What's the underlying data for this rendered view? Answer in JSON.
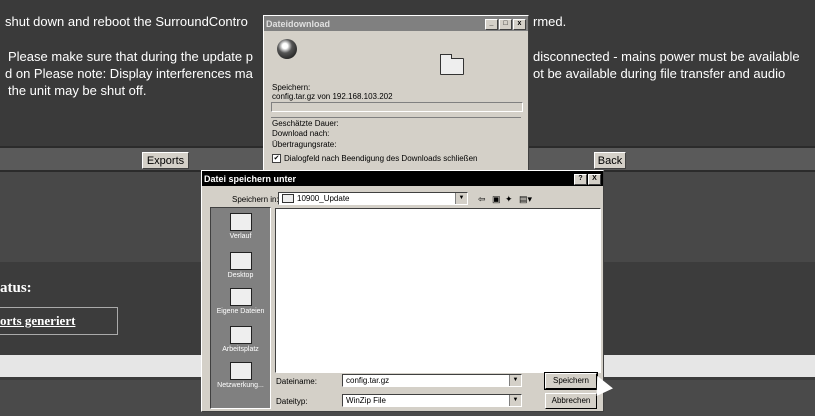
{
  "background": {
    "line1_left": "shut down and reboot the SurroundContro",
    "line1_right": "rmed.",
    "line2_left": "Please make sure that during the update p",
    "line2_right": "disconnected - mains power must be available",
    "line3_left": "d on Please note: Display interferences ma",
    "line3_right": "ot be available during file transfer and audio",
    "line4_left": "the unit may be shut off.",
    "exports_button": "Exports",
    "back_button": "Back",
    "status_label": "atus:",
    "reports_link": "orts generiert"
  },
  "download_dialog": {
    "title": "Dateidownload",
    "saving_label": "Speichern:",
    "saving_value": "config.tar.gz von 192.168.103.202",
    "estimated_label": "Geschätzte Dauer:",
    "download_to_label": "Download nach:",
    "transfer_rate_label": "Übertragungsrate:",
    "close_checkbox_label": "Dialogfeld nach Beendigung des Downloads schließen",
    "close_checkbox_checked": true
  },
  "save_dialog": {
    "title": "Datei speichern unter",
    "save_in_label": "Speichern in:",
    "save_in_value": "10900_Update",
    "places": [
      {
        "label": "Verlauf",
        "icon": "history-icon"
      },
      {
        "label": "Desktop",
        "icon": "desktop-icon"
      },
      {
        "label": "Eigene Dateien",
        "icon": "my-documents-icon"
      },
      {
        "label": "Arbeitsplatz",
        "icon": "my-computer-icon"
      },
      {
        "label": "Netzwerkung...",
        "icon": "network-icon"
      }
    ],
    "filename_label": "Dateiname:",
    "filename_value": "config.tar.gz",
    "filetype_label": "Dateityp:",
    "filetype_value": "WinZip File",
    "save_button": "Speichern",
    "cancel_button": "Abbrechen",
    "help_button": "?",
    "close_button": "X"
  }
}
